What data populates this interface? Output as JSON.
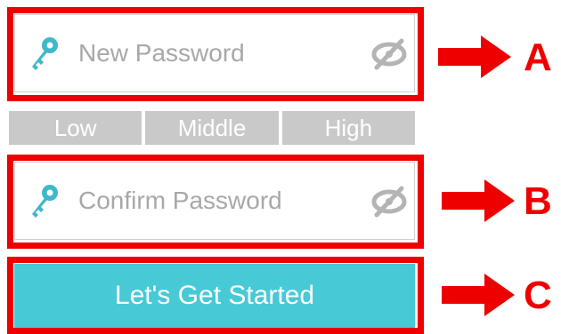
{
  "form": {
    "new_password": {
      "placeholder": "New Password",
      "icon": "key-icon",
      "toggle_icon": "eye-slash-icon"
    },
    "strength_levels": [
      "Low",
      "Middle",
      "High"
    ],
    "confirm_password": {
      "placeholder": "Confirm Password",
      "icon": "key-icon",
      "toggle_icon": "eye-slash-icon"
    },
    "submit_label": "Let's Get Started"
  },
  "callouts": [
    {
      "letter": "A",
      "target": "new-password-field"
    },
    {
      "letter": "B",
      "target": "confirm-password-field"
    },
    {
      "letter": "C",
      "target": "start-button"
    }
  ],
  "colors": {
    "annotation_red": "#ee0000",
    "button_teal": "#48c9d6",
    "key_teal": "#3fb8c8",
    "strength_gray": "#c9c9c9",
    "placeholder_gray": "#a8a8a8"
  }
}
